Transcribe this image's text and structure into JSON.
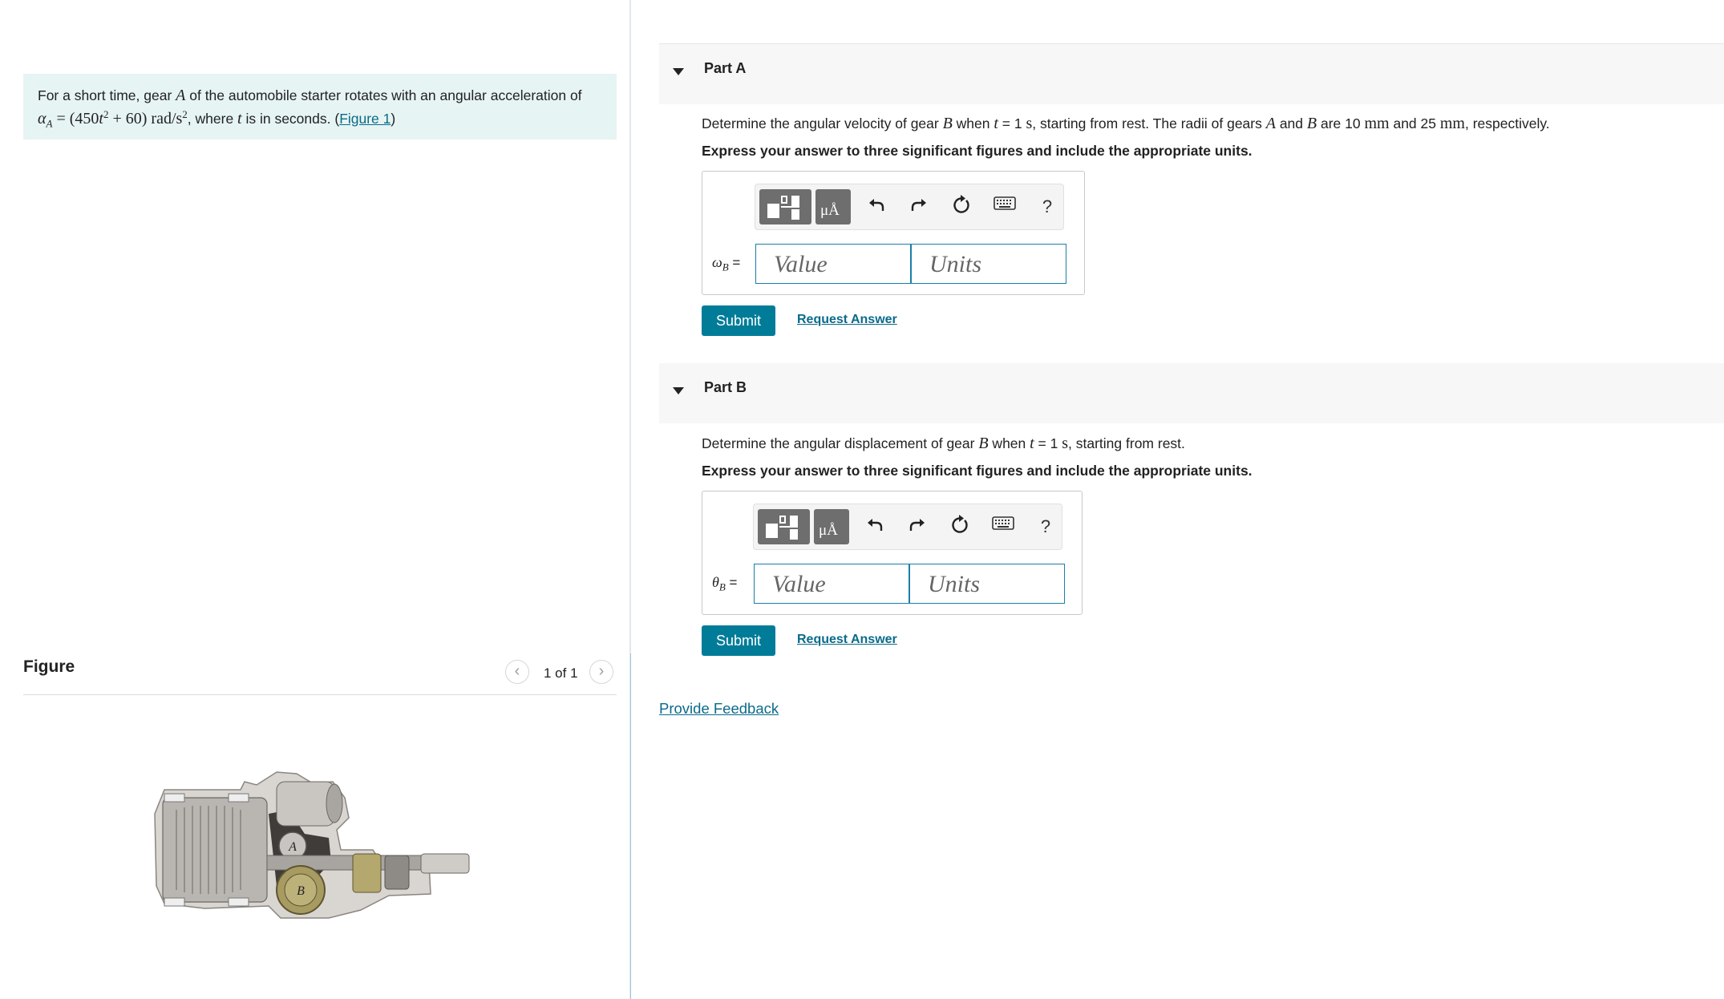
{
  "problem": {
    "text1": "For a short time, gear ",
    "gearA": "A",
    "text2": " of the automobile starter rotates with an angular acceleration of",
    "alpha": "α",
    "alpha_sub": "A",
    "eq1": " = (450",
    "t_var": "t",
    "sup2": "2",
    "eq2": " + 60) rad/s",
    "eq3": "2",
    "text3": ", where ",
    "t_var2": "t",
    "text4": " is in seconds. (",
    "figure_link": "Figure 1",
    "text5": ")"
  },
  "figure": {
    "title": "Figure",
    "prev_glyph": "‹",
    "next_glyph": "›",
    "pager": "1 of 1",
    "label_a": "A",
    "label_b": "B"
  },
  "partA": {
    "title": "Part A",
    "q1": "Determine the angular velocity of gear ",
    "gear": "B",
    "q2": " when ",
    "t": "t",
    "q3": " = 1 ",
    "s": "s",
    "q4": ", starting from rest. The radii of gears ",
    "ga": "A",
    "q5": " and ",
    "gb": "B",
    "q6": " are 10 ",
    "mm1": "mm",
    "q7": " and 25 ",
    "mm2": "mm",
    "q8": ", respectively.",
    "instruction": "Express your answer to three significant figures and include the appropriate units.",
    "var_symbol": "ω",
    "var_sub": "B",
    "var_eq": " =",
    "value_placeholder": "Value",
    "units_placeholder": "Units",
    "units_icon_text": "μÅ",
    "help": "?",
    "submit": "Submit",
    "request": "Request Answer"
  },
  "partB": {
    "title": "Part B",
    "q1": "Determine the angular displacement of gear ",
    "gear": "B",
    "q2": " when ",
    "t": "t",
    "q3": " = 1 ",
    "s": "s",
    "q4": ", starting from rest.",
    "instruction": "Express your answer to three significant figures and include the appropriate units.",
    "var_symbol": "θ",
    "var_sub": "B",
    "var_eq": " =",
    "value_placeholder": "Value",
    "units_placeholder": "Units",
    "units_icon_text": "μÅ",
    "help": "?",
    "submit": "Submit",
    "request": "Request Answer"
  },
  "feedback": "Provide Feedback",
  "colors": {
    "accent": "#007c99",
    "link": "#0a6b8a",
    "problem_bg": "#e6f4f3",
    "field_border": "#1a7fa7"
  }
}
